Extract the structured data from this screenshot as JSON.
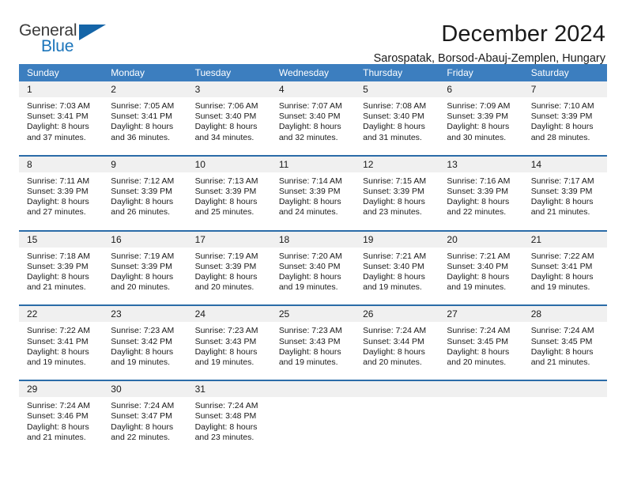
{
  "logo": {
    "text_top": "General",
    "text_bottom": "Blue",
    "triangle_color": "#1565a8",
    "blue_color": "#1b75bb"
  },
  "header": {
    "title": "December 2024",
    "subtitle": "Sarospatak, Borsod-Abauj-Zemplen, Hungary"
  },
  "theme": {
    "header_blue": "#3c7ebf",
    "row_rule_blue": "#2b6ca8",
    "day_band_gray": "#f0f0f0"
  },
  "weekdays": [
    "Sunday",
    "Monday",
    "Tuesday",
    "Wednesday",
    "Thursday",
    "Friday",
    "Saturday"
  ],
  "weeks": [
    [
      {
        "day": "1",
        "sunrise": "Sunrise: 7:03 AM",
        "sunset": "Sunset: 3:41 PM",
        "daylight1": "Daylight: 8 hours",
        "daylight2": "and 37 minutes."
      },
      {
        "day": "2",
        "sunrise": "Sunrise: 7:05 AM",
        "sunset": "Sunset: 3:41 PM",
        "daylight1": "Daylight: 8 hours",
        "daylight2": "and 36 minutes."
      },
      {
        "day": "3",
        "sunrise": "Sunrise: 7:06 AM",
        "sunset": "Sunset: 3:40 PM",
        "daylight1": "Daylight: 8 hours",
        "daylight2": "and 34 minutes."
      },
      {
        "day": "4",
        "sunrise": "Sunrise: 7:07 AM",
        "sunset": "Sunset: 3:40 PM",
        "daylight1": "Daylight: 8 hours",
        "daylight2": "and 32 minutes."
      },
      {
        "day": "5",
        "sunrise": "Sunrise: 7:08 AM",
        "sunset": "Sunset: 3:40 PM",
        "daylight1": "Daylight: 8 hours",
        "daylight2": "and 31 minutes."
      },
      {
        "day": "6",
        "sunrise": "Sunrise: 7:09 AM",
        "sunset": "Sunset: 3:39 PM",
        "daylight1": "Daylight: 8 hours",
        "daylight2": "and 30 minutes."
      },
      {
        "day": "7",
        "sunrise": "Sunrise: 7:10 AM",
        "sunset": "Sunset: 3:39 PM",
        "daylight1": "Daylight: 8 hours",
        "daylight2": "and 28 minutes."
      }
    ],
    [
      {
        "day": "8",
        "sunrise": "Sunrise: 7:11 AM",
        "sunset": "Sunset: 3:39 PM",
        "daylight1": "Daylight: 8 hours",
        "daylight2": "and 27 minutes."
      },
      {
        "day": "9",
        "sunrise": "Sunrise: 7:12 AM",
        "sunset": "Sunset: 3:39 PM",
        "daylight1": "Daylight: 8 hours",
        "daylight2": "and 26 minutes."
      },
      {
        "day": "10",
        "sunrise": "Sunrise: 7:13 AM",
        "sunset": "Sunset: 3:39 PM",
        "daylight1": "Daylight: 8 hours",
        "daylight2": "and 25 minutes."
      },
      {
        "day": "11",
        "sunrise": "Sunrise: 7:14 AM",
        "sunset": "Sunset: 3:39 PM",
        "daylight1": "Daylight: 8 hours",
        "daylight2": "and 24 minutes."
      },
      {
        "day": "12",
        "sunrise": "Sunrise: 7:15 AM",
        "sunset": "Sunset: 3:39 PM",
        "daylight1": "Daylight: 8 hours",
        "daylight2": "and 23 minutes."
      },
      {
        "day": "13",
        "sunrise": "Sunrise: 7:16 AM",
        "sunset": "Sunset: 3:39 PM",
        "daylight1": "Daylight: 8 hours",
        "daylight2": "and 22 minutes."
      },
      {
        "day": "14",
        "sunrise": "Sunrise: 7:17 AM",
        "sunset": "Sunset: 3:39 PM",
        "daylight1": "Daylight: 8 hours",
        "daylight2": "and 21 minutes."
      }
    ],
    [
      {
        "day": "15",
        "sunrise": "Sunrise: 7:18 AM",
        "sunset": "Sunset: 3:39 PM",
        "daylight1": "Daylight: 8 hours",
        "daylight2": "and 21 minutes."
      },
      {
        "day": "16",
        "sunrise": "Sunrise: 7:19 AM",
        "sunset": "Sunset: 3:39 PM",
        "daylight1": "Daylight: 8 hours",
        "daylight2": "and 20 minutes."
      },
      {
        "day": "17",
        "sunrise": "Sunrise: 7:19 AM",
        "sunset": "Sunset: 3:39 PM",
        "daylight1": "Daylight: 8 hours",
        "daylight2": "and 20 minutes."
      },
      {
        "day": "18",
        "sunrise": "Sunrise: 7:20 AM",
        "sunset": "Sunset: 3:40 PM",
        "daylight1": "Daylight: 8 hours",
        "daylight2": "and 19 minutes."
      },
      {
        "day": "19",
        "sunrise": "Sunrise: 7:21 AM",
        "sunset": "Sunset: 3:40 PM",
        "daylight1": "Daylight: 8 hours",
        "daylight2": "and 19 minutes."
      },
      {
        "day": "20",
        "sunrise": "Sunrise: 7:21 AM",
        "sunset": "Sunset: 3:40 PM",
        "daylight1": "Daylight: 8 hours",
        "daylight2": "and 19 minutes."
      },
      {
        "day": "21",
        "sunrise": "Sunrise: 7:22 AM",
        "sunset": "Sunset: 3:41 PM",
        "daylight1": "Daylight: 8 hours",
        "daylight2": "and 19 minutes."
      }
    ],
    [
      {
        "day": "22",
        "sunrise": "Sunrise: 7:22 AM",
        "sunset": "Sunset: 3:41 PM",
        "daylight1": "Daylight: 8 hours",
        "daylight2": "and 19 minutes."
      },
      {
        "day": "23",
        "sunrise": "Sunrise: 7:23 AM",
        "sunset": "Sunset: 3:42 PM",
        "daylight1": "Daylight: 8 hours",
        "daylight2": "and 19 minutes."
      },
      {
        "day": "24",
        "sunrise": "Sunrise: 7:23 AM",
        "sunset": "Sunset: 3:43 PM",
        "daylight1": "Daylight: 8 hours",
        "daylight2": "and 19 minutes."
      },
      {
        "day": "25",
        "sunrise": "Sunrise: 7:23 AM",
        "sunset": "Sunset: 3:43 PM",
        "daylight1": "Daylight: 8 hours",
        "daylight2": "and 19 minutes."
      },
      {
        "day": "26",
        "sunrise": "Sunrise: 7:24 AM",
        "sunset": "Sunset: 3:44 PM",
        "daylight1": "Daylight: 8 hours",
        "daylight2": "and 20 minutes."
      },
      {
        "day": "27",
        "sunrise": "Sunrise: 7:24 AM",
        "sunset": "Sunset: 3:45 PM",
        "daylight1": "Daylight: 8 hours",
        "daylight2": "and 20 minutes."
      },
      {
        "day": "28",
        "sunrise": "Sunrise: 7:24 AM",
        "sunset": "Sunset: 3:45 PM",
        "daylight1": "Daylight: 8 hours",
        "daylight2": "and 21 minutes."
      }
    ],
    [
      {
        "day": "29",
        "sunrise": "Sunrise: 7:24 AM",
        "sunset": "Sunset: 3:46 PM",
        "daylight1": "Daylight: 8 hours",
        "daylight2": "and 21 minutes."
      },
      {
        "day": "30",
        "sunrise": "Sunrise: 7:24 AM",
        "sunset": "Sunset: 3:47 PM",
        "daylight1": "Daylight: 8 hours",
        "daylight2": "and 22 minutes."
      },
      {
        "day": "31",
        "sunrise": "Sunrise: 7:24 AM",
        "sunset": "Sunset: 3:48 PM",
        "daylight1": "Daylight: 8 hours",
        "daylight2": "and 23 minutes."
      },
      {
        "day": "",
        "sunrise": "",
        "sunset": "",
        "daylight1": "",
        "daylight2": ""
      },
      {
        "day": "",
        "sunrise": "",
        "sunset": "",
        "daylight1": "",
        "daylight2": ""
      },
      {
        "day": "",
        "sunrise": "",
        "sunset": "",
        "daylight1": "",
        "daylight2": ""
      },
      {
        "day": "",
        "sunrise": "",
        "sunset": "",
        "daylight1": "",
        "daylight2": ""
      }
    ]
  ]
}
